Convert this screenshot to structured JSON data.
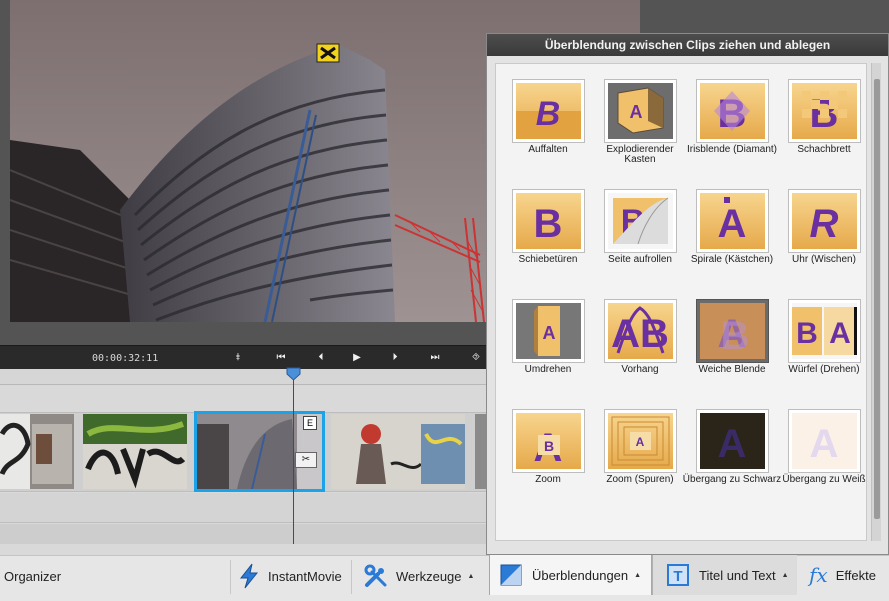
{
  "transport": {
    "timecode": "00:00:32:11"
  },
  "panel": {
    "title": "Überblendung zwischen Clips ziehen und ablegen",
    "transitions": [
      {
        "label": "Auffalten",
        "icon": "fold-transition-icon"
      },
      {
        "label": "Explodierender Kasten",
        "icon": "exploding-box-transition-icon"
      },
      {
        "label": "Irisblende (Diamant)",
        "icon": "iris-diamond-transition-icon"
      },
      {
        "label": "Schachbrett",
        "icon": "checkerboard-transition-icon"
      },
      {
        "label": "Schiebetüren",
        "icon": "sliding-doors-transition-icon"
      },
      {
        "label": "Seite aufrollen",
        "icon": "page-curl-transition-icon"
      },
      {
        "label": "Spirale (Kästchen)",
        "icon": "spiral-boxes-transition-icon"
      },
      {
        "label": "Uhr (Wischen)",
        "icon": "clock-wipe-transition-icon"
      },
      {
        "label": "Umdrehen",
        "icon": "flip-transition-icon"
      },
      {
        "label": "Vorhang",
        "icon": "curtain-transition-icon"
      },
      {
        "label": "Weiche Blende",
        "icon": "soft-dissolve-transition-icon"
      },
      {
        "label": "Würfel (Drehen)",
        "icon": "cube-spin-transition-icon"
      },
      {
        "label": "Zoom",
        "icon": "zoom-transition-icon"
      },
      {
        "label": "Zoom (Spuren)",
        "icon": "zoom-trails-transition-icon"
      },
      {
        "label": "Übergang zu Schwarz",
        "icon": "fade-to-black-transition-icon"
      },
      {
        "label": "Übergang zu Weiß",
        "icon": "fade-to-white-transition-icon"
      }
    ]
  },
  "bottombar": {
    "organizer": "Organizer",
    "instantmovie": "InstantMovie",
    "werkzeuge": "Werkzeuge"
  },
  "panel_tabs": {
    "ueberblendungen": "Überblendungen",
    "titel_text": "Titel und Text",
    "effekte": "Effekte"
  },
  "colors": {
    "accent_blue": "#1aa3e8",
    "playhead_red": "#d0111b",
    "tile_gold": "#f0c06a",
    "glyph_purple": "#6a2fa0"
  }
}
